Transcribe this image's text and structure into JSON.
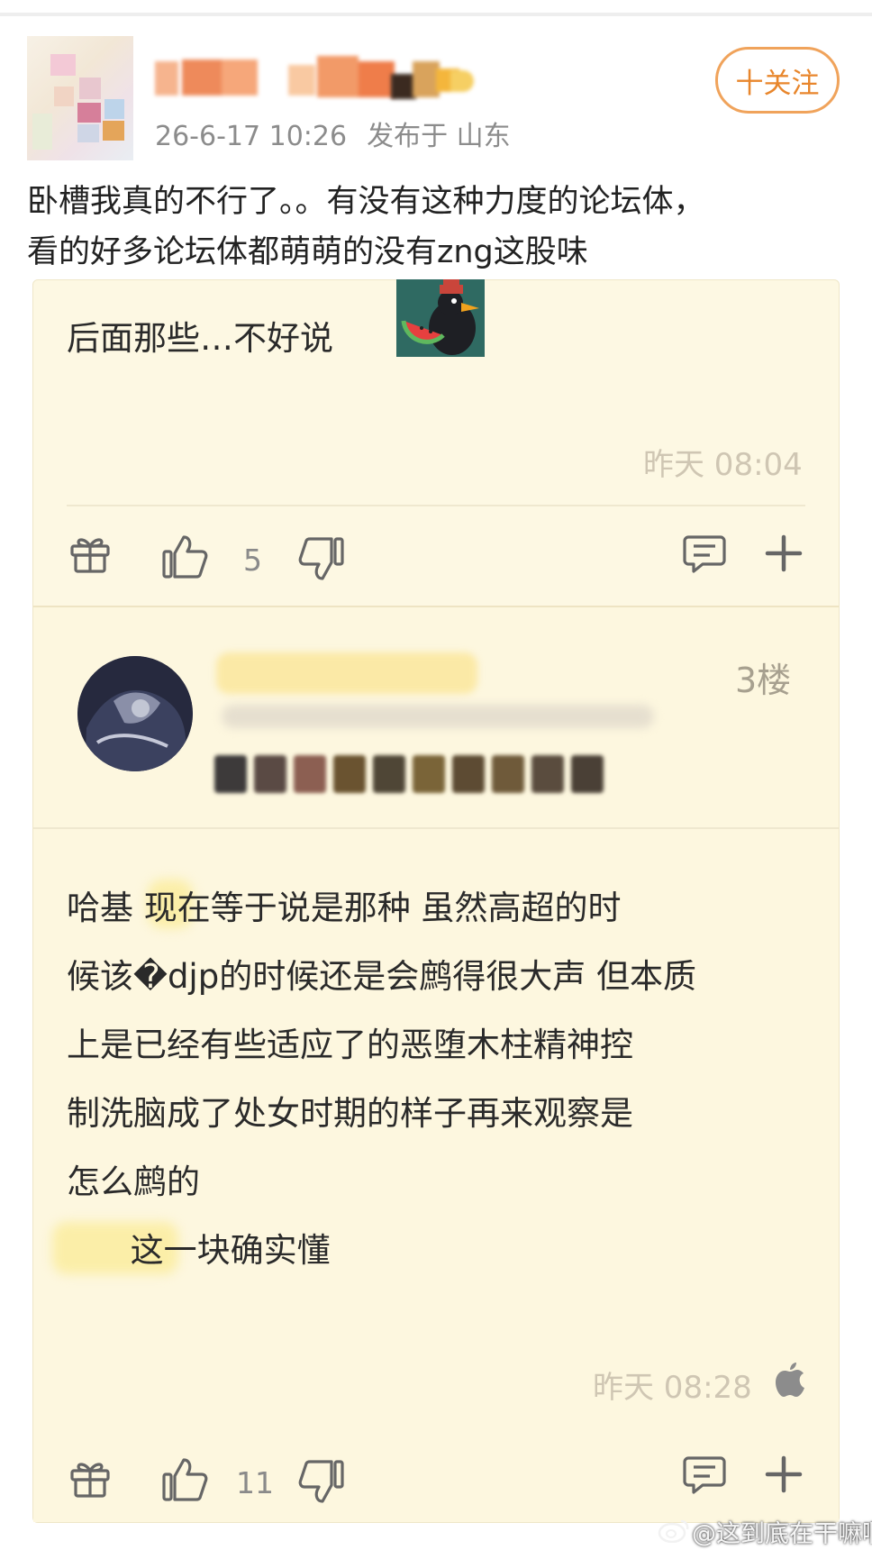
{
  "post": {
    "timestamp": "26-6-17 10:26",
    "location": "发布于 山东",
    "follow_label": "十关注",
    "text_lines": [
      "卧槽我真的不行了。。有没有这种力度的论坛体，",
      "看的好多论坛体都萌萌的没有zng这股味"
    ]
  },
  "reply1": {
    "text": "后面那些…不好说",
    "time": "昨天 08:04",
    "likes": "5"
  },
  "reply3": {
    "floor": "3楼",
    "lines": [
      "哈基   现在等于说是那种 虽然高超的时",
      "候该�djp的时候还是会鹧得很大声 但本质",
      "上是已经有些适应了的恶堕木柱精神控",
      "制洗脑成了处女时期的样子再来观察是",
      "怎么鹧的",
      "      这一块确实懂"
    ],
    "time": "昨天 08:28",
    "likes": "11"
  },
  "watermark": "@这到底在干嘛啊",
  "colors": {
    "accent": "#e8862c",
    "card_bg": "#fdf8e3",
    "timestamp": "#cfc6b3"
  },
  "icons": [
    "gift-icon",
    "thumbs-up-icon",
    "thumbs-down-icon",
    "comment-icon",
    "plus-icon",
    "apple-icon",
    "weibo-icon"
  ]
}
